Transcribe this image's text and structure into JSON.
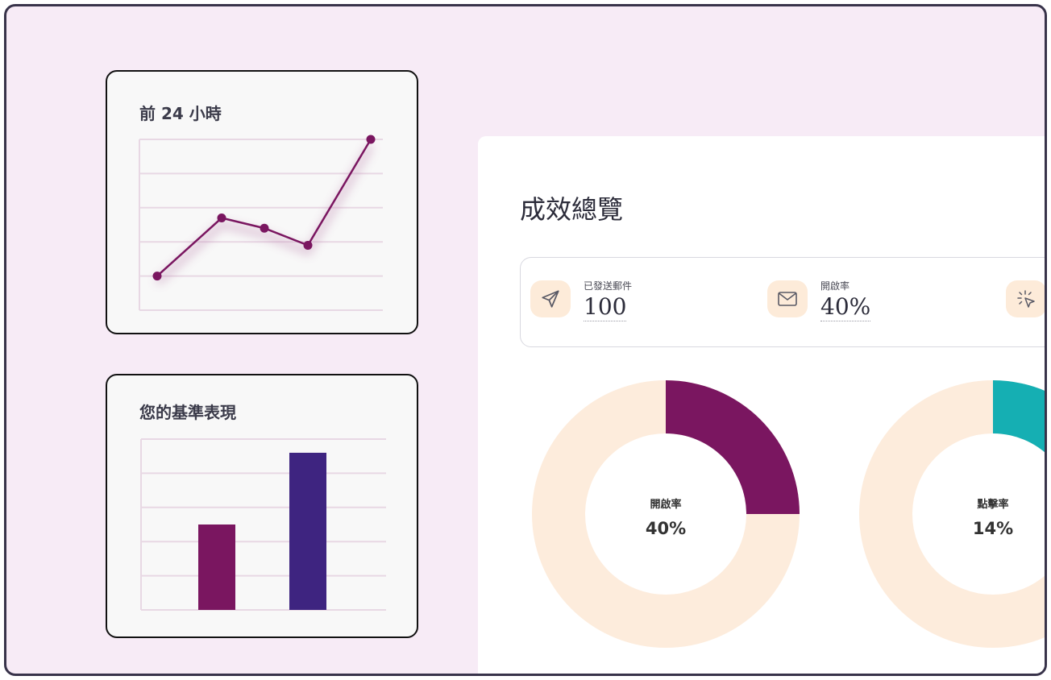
{
  "line_card": {
    "title": "前 24 小時",
    "chart_data": {
      "type": "line",
      "x": [
        1,
        2,
        3,
        4,
        5
      ],
      "values": [
        1,
        2.7,
        2.4,
        1.9,
        5
      ],
      "ylim": [
        0,
        5
      ],
      "grid": true,
      "color": "#7a1660"
    }
  },
  "bar_card": {
    "title": "您的基準表現",
    "chart_data": {
      "type": "bar",
      "categories": [
        "",
        ""
      ],
      "values": [
        2.5,
        4.6
      ],
      "ylim": [
        0,
        5
      ],
      "grid": true,
      "colors": [
        "#7a1660",
        "#3e2480"
      ]
    }
  },
  "overview": {
    "title": "成效總覽",
    "stats": [
      {
        "icon": "send-icon",
        "label": "已發送郵件",
        "value": "100"
      },
      {
        "icon": "mail-icon",
        "label": "開啟率",
        "value": "40%"
      },
      {
        "icon": "cursor-click-icon",
        "label": "",
        "value": ""
      }
    ],
    "donuts": [
      {
        "label": "開啟率",
        "value": "40%",
        "percent": 25,
        "color": "#7a1660",
        "track": "#fdecdc"
      },
      {
        "label": "點擊率",
        "value": "14%",
        "percent": 14,
        "color": "#15afb3",
        "track": "#fdecdc"
      }
    ]
  },
  "colors": {
    "background": "#f7ebf6",
    "accent": "#7a1660",
    "bar2": "#3e2480",
    "teal": "#15afb3",
    "icon_bg": "#fdebd9"
  }
}
